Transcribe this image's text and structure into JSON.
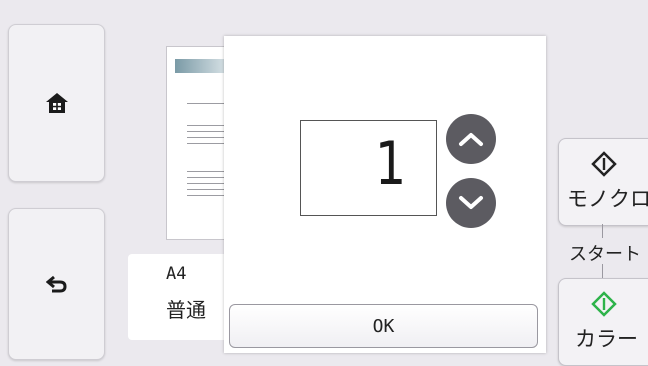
{
  "nav": {
    "home_icon": "home-icon",
    "back_icon": "back-arrow-icon"
  },
  "paper": {
    "size": "A4",
    "type": "普通"
  },
  "copies_dialog": {
    "count": "1",
    "up_icon": "chevron-up-icon",
    "down_icon": "chevron-down-icon",
    "ok_label": "OK"
  },
  "start": {
    "mono_label": "モノクロ",
    "start_label": "スタート",
    "color_label": "カラー",
    "mono_icon_color": "#222222",
    "color_icon_color": "#2db34a"
  },
  "colors": {
    "background": "#ebe9ee",
    "round_button": "#5c5b61"
  }
}
